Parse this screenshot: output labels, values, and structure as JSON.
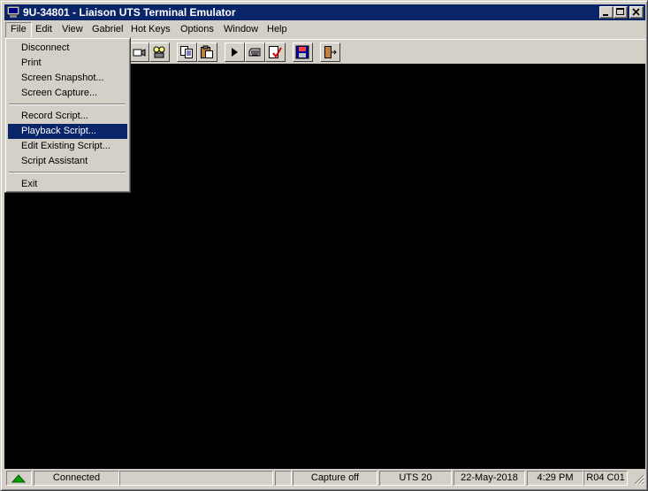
{
  "window": {
    "title": "9U-34801 - Liaison UTS Terminal Emulator"
  },
  "menubar": [
    "File",
    "Edit",
    "View",
    "Gabriel",
    "Hot Keys",
    "Options",
    "Window",
    "Help"
  ],
  "file_menu": {
    "group1": [
      "Disconnect",
      "Print",
      "Screen Snapshot...",
      "Screen Capture..."
    ],
    "group2": [
      "Record Script...",
      "Playback Script...",
      "Edit Existing Script...",
      "Script Assistant"
    ],
    "group3": [
      "Exit"
    ],
    "highlighted": "Playback Script..."
  },
  "toolbar_icons": [
    "camera-icon",
    "film-reel-icon",
    "copy-icon",
    "paste-icon",
    "play-icon",
    "keyboard-icon",
    "checklist-icon",
    "disk-icon",
    "exit-door-icon"
  ],
  "status": {
    "connection": "Connected",
    "capture": "Capture off",
    "terminal_type": "UTS 20",
    "date": "22-May-2018",
    "time": "4:29 PM",
    "cursor": "R04 C01"
  },
  "colors": {
    "title_bar": "#0a246a",
    "terminal_bg": "#000000",
    "highlight": "#0a246a",
    "status_ok": "#00a000"
  }
}
